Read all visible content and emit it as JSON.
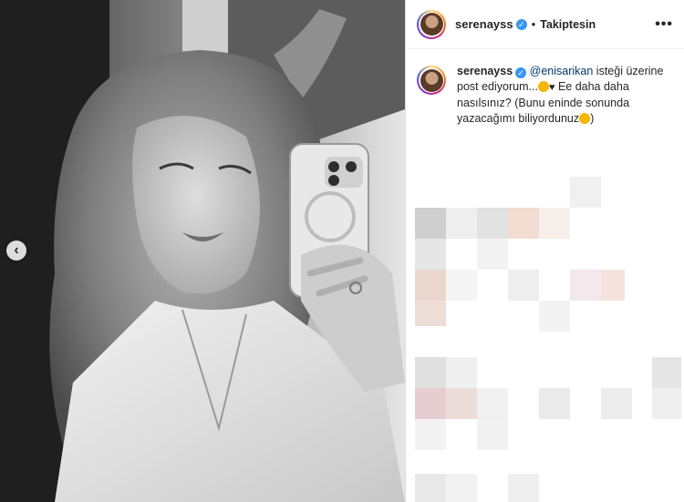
{
  "header": {
    "username": "serenayss",
    "separator": "•",
    "follow_status": "Takiptesin",
    "more_label": "•••"
  },
  "caption": {
    "username": "serenayss",
    "mention": "@enisarikan",
    "text_1": " isteği üzerine post ediyorum...",
    "text_2": " Ee daha daha nasılsınız? (Bunu eninde sonunda yazacağımı biliyordunuz",
    "text_3": ")"
  },
  "media": {
    "prev_label": "‹"
  },
  "colors": {
    "verified": "#3897f0",
    "mention": "#00376b",
    "text": "#262626"
  },
  "icons": [
    "chevron-left-icon",
    "verified-badge-icon",
    "more-options-icon",
    "smile-emoji-icon",
    "heart-icon"
  ]
}
